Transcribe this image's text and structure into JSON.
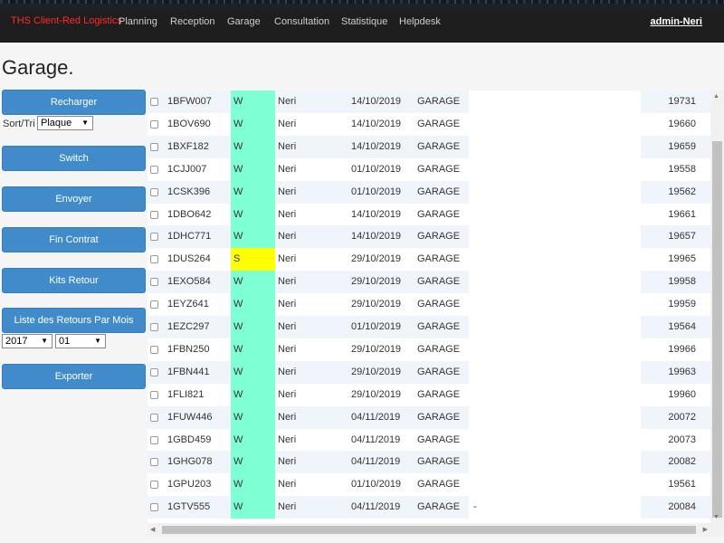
{
  "navbar": {
    "brand": "THS Client-Red Logistics",
    "items": [
      "Planning",
      "Reception",
      "Garage",
      "Consultation",
      "Statistique",
      "Helpdesk"
    ],
    "user": "admin-Neri"
  },
  "page": {
    "title": "Garage."
  },
  "sidebar": {
    "reload_label": "Recharger",
    "sort_label": "Sort/Tri :",
    "sort_value": "Plaque",
    "switch_label": "Switch",
    "send_label": "Envoyer",
    "end_contract_label": "Fin Contrat",
    "kits_return_label": "Kits Retour",
    "monthly_returns_label": "Liste des Retours Par Mois",
    "year_value": "2017",
    "month_value": "01",
    "export_label": "Exporter"
  },
  "colors": {
    "code_W": "#7fffd4",
    "code_S": "#ffff00",
    "button": "#428bca",
    "brand": "#ff2a2a"
  },
  "table": {
    "rows": [
      {
        "plate": "1BFW007",
        "code": "W",
        "user": "Neri",
        "date": "14/10/2019",
        "status": "GARAGE",
        "note": "",
        "id": "19731"
      },
      {
        "plate": "1BOV690",
        "code": "W",
        "user": "Neri",
        "date": "14/10/2019",
        "status": "GARAGE",
        "note": "",
        "id": "19660"
      },
      {
        "plate": "1BXF182",
        "code": "W",
        "user": "Neri",
        "date": "14/10/2019",
        "status": "GARAGE",
        "note": "",
        "id": "19659"
      },
      {
        "plate": "1CJJ007",
        "code": "W",
        "user": "Neri",
        "date": "01/10/2019",
        "status": "GARAGE",
        "note": "",
        "id": "19558"
      },
      {
        "plate": "1CSK396",
        "code": "W",
        "user": "Neri",
        "date": "01/10/2019",
        "status": "GARAGE",
        "note": "",
        "id": "19562"
      },
      {
        "plate": "1DBO642",
        "code": "W",
        "user": "Neri",
        "date": "14/10/2019",
        "status": "GARAGE",
        "note": "",
        "id": "19661"
      },
      {
        "plate": "1DHC771",
        "code": "W",
        "user": "Neri",
        "date": "14/10/2019",
        "status": "GARAGE",
        "note": "",
        "id": "19657"
      },
      {
        "plate": "1DUS264",
        "code": "S",
        "user": "Neri",
        "date": "29/10/2019",
        "status": "GARAGE",
        "note": "",
        "id": "19965"
      },
      {
        "plate": "1EXO584",
        "code": "W",
        "user": "Neri",
        "date": "29/10/2019",
        "status": "GARAGE",
        "note": "",
        "id": "19958"
      },
      {
        "plate": "1EYZ641",
        "code": "W",
        "user": "Neri",
        "date": "29/10/2019",
        "status": "GARAGE",
        "note": "",
        "id": "19959"
      },
      {
        "plate": "1EZC297",
        "code": "W",
        "user": "Neri",
        "date": "01/10/2019",
        "status": "GARAGE",
        "note": "",
        "id": "19564"
      },
      {
        "plate": "1FBN250",
        "code": "W",
        "user": "Neri",
        "date": "29/10/2019",
        "status": "GARAGE",
        "note": "",
        "id": "19966"
      },
      {
        "plate": "1FBN441",
        "code": "W",
        "user": "Neri",
        "date": "29/10/2019",
        "status": "GARAGE",
        "note": "",
        "id": "19963"
      },
      {
        "plate": "1FLI821",
        "code": "W",
        "user": "Neri",
        "date": "29/10/2019",
        "status": "GARAGE",
        "note": "",
        "id": "19960"
      },
      {
        "plate": "1FUW446",
        "code": "W",
        "user": "Neri",
        "date": "04/11/2019",
        "status": "GARAGE",
        "note": "",
        "id": "20072"
      },
      {
        "plate": "1GBD459",
        "code": "W",
        "user": "Neri",
        "date": "04/11/2019",
        "status": "GARAGE",
        "note": "",
        "id": "20073"
      },
      {
        "plate": "1GHG078",
        "code": "W",
        "user": "Neri",
        "date": "04/11/2019",
        "status": "GARAGE",
        "note": "",
        "id": "20082"
      },
      {
        "plate": "1GPU203",
        "code": "W",
        "user": "Neri",
        "date": "01/10/2019",
        "status": "GARAGE",
        "note": "",
        "id": "19561"
      },
      {
        "plate": "1GTV555",
        "code": "W",
        "user": "Neri",
        "date": "04/11/2019",
        "status": "GARAGE",
        "note": "-",
        "id": "20084"
      }
    ]
  }
}
